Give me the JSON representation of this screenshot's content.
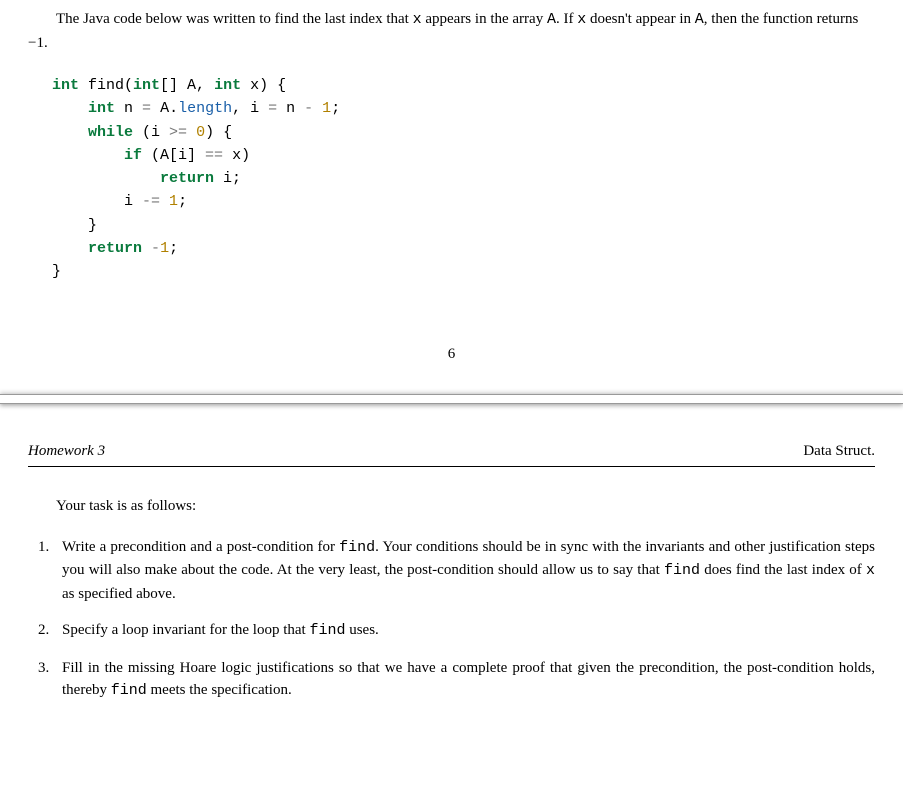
{
  "intro_parts": {
    "t1": "The Java code below was written to find the last index that ",
    "x": "x",
    "t2": " appears in the array ",
    "A": "A",
    "t3": ". If ",
    "t4": " doesn't appear in ",
    "t5": ", then the function returns ",
    "neg1": "−1",
    "t6": "."
  },
  "code": {
    "kw_int1": "int",
    "fn_name": " find(",
    "kw_int2": "int",
    "param_arr": "[] A, ",
    "kw_int3": "int",
    "param_x": " x) {",
    "line2a": "    ",
    "kw_int4": "int",
    "line2b": " n ",
    "op_eq1": "=",
    "line2c": " A.",
    "attr_len": "length",
    "line2d": ", i ",
    "op_eq2": "=",
    "line2e": " n ",
    "op_minus1": "-",
    "sp1": " ",
    "num1": "1",
    "semi1": ";",
    "line3a": "    ",
    "kw_while": "while",
    "line3b": " (i ",
    "op_ge": ">=",
    "sp2": " ",
    "num0": "0",
    "line3c": ") {",
    "line4a": "        ",
    "kw_if": "if",
    "line4b": " (A[i] ",
    "op_eqeq": "==",
    "line4c": " x)",
    "line5a": "            ",
    "kw_ret1": "return",
    "line5b": " i;",
    "line6a": "        i ",
    "op_me": "-=",
    "sp3": " ",
    "num1b": "1",
    "semi2": ";",
    "line7": "    }",
    "line8a": "    ",
    "kw_ret2": "return",
    "sp4": " ",
    "op_neg": "-",
    "num1c": "1",
    "semi3": ";",
    "line9": "}"
  },
  "page_number": "6",
  "header": {
    "left": "Homework 3",
    "right": "Data Struct."
  },
  "task_intro": "Your task is as follows:",
  "tasks": {
    "t1": {
      "p1": "Write a precondition and a post-condition for ",
      "find": "find",
      "p2": ". Your conditions should be in sync with the invariants and other justification steps you will also make about the code. At the very least, the post-condition should allow us to say that ",
      "p3": " does find the last index of ",
      "x": "x",
      "p4": " as specified above."
    },
    "t2": {
      "p1": "Specify a loop invariant for the loop that ",
      "find": "find",
      "p2": " uses."
    },
    "t3": {
      "p1": "Fill in the missing Hoare logic justifications so that we have a complete proof that given the precondition, the post-condition holds, thereby ",
      "find": "find",
      "p2": " meets the specification."
    }
  }
}
